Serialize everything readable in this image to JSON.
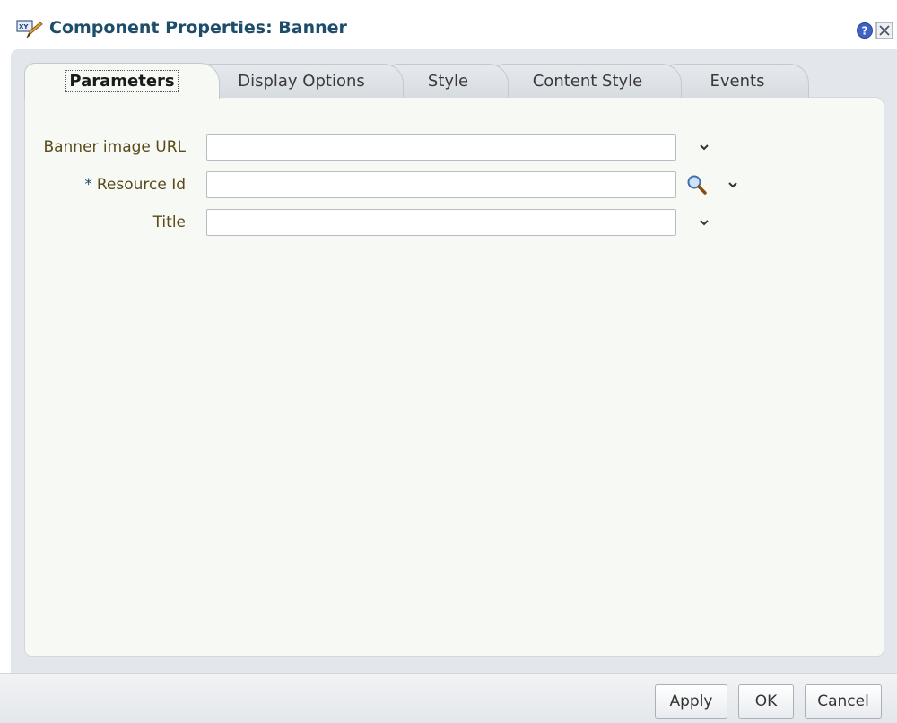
{
  "dialog": {
    "title": "Component Properties: Banner",
    "title_icon": "component-edit-icon",
    "help_icon": "help-icon",
    "close_icon": "close-icon"
  },
  "tabs": [
    {
      "label": "Parameters",
      "active": true
    },
    {
      "label": "Display Options",
      "active": false
    },
    {
      "label": "Style",
      "active": false
    },
    {
      "label": "Content Style",
      "active": false
    },
    {
      "label": "Events",
      "active": false
    }
  ],
  "fields": [
    {
      "label": "Banner image URL",
      "required": false,
      "value": "",
      "has_search": false
    },
    {
      "label": "Resource Id",
      "required": true,
      "required_mark": "*",
      "value": "",
      "has_search": true
    },
    {
      "label": "Title",
      "required": false,
      "value": "",
      "has_search": false
    }
  ],
  "footer": {
    "apply_label": "Apply",
    "ok_label": "OK",
    "cancel_label": "Cancel"
  },
  "colors": {
    "title_text": "#1d4d6b",
    "label_text": "#5a4a1a",
    "content_bg": "#f7f9f5",
    "frame_bg": "#e3e6ea"
  }
}
